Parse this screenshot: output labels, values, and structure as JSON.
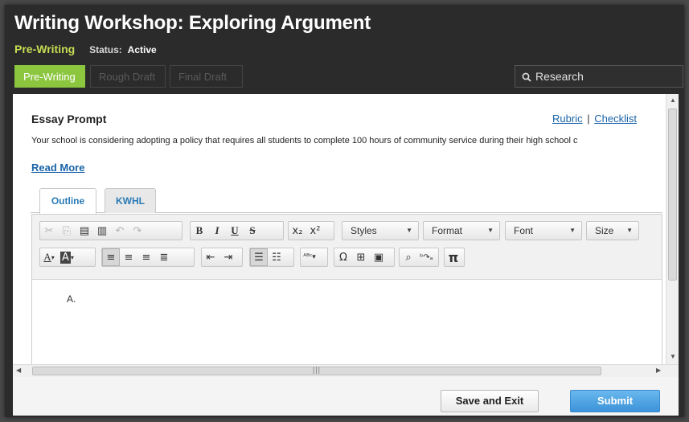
{
  "header": {
    "title": "Writing Workshop: Exploring Argument",
    "phase": "Pre-Writing",
    "status_label": "Status:",
    "status_value": "Active"
  },
  "stage_tabs": [
    {
      "label": "Pre-Writing",
      "active": true
    },
    {
      "label": "Rough Draft",
      "active": false
    },
    {
      "label": "Final Draft",
      "active": false
    }
  ],
  "research": {
    "label": "Research",
    "icon": "search-icon"
  },
  "prompt": {
    "title": "Essay Prompt",
    "text": "Your school is considering adopting a policy that requires all students to complete 100 hours of community service during their high school c",
    "read_more": "Read More",
    "rubric_link": "Rubric",
    "separator": "|",
    "checklist_link": "Checklist"
  },
  "editor_tabs": [
    {
      "label": "Outline",
      "active": true
    },
    {
      "label": "KWHL",
      "active": false
    }
  ],
  "toolbar": {
    "styles": "Styles",
    "format": "Format",
    "font": "Font",
    "size": "Size",
    "bold": "B",
    "italic": "I",
    "underline": "U",
    "strike": "S",
    "special_char": "Ω",
    "pi": "π",
    "text_color": "A",
    "bg_color": "A"
  },
  "content": {
    "outline_text": "A."
  },
  "footer": {
    "save_label": "Save and Exit",
    "submit_label": "Submit"
  },
  "colors": {
    "accent_green": "#8cc63f",
    "phase_green": "#c6de54",
    "link_blue": "#1a64a8",
    "submit_blue": "#3b93d8",
    "header_bg": "#2b2b2b"
  }
}
